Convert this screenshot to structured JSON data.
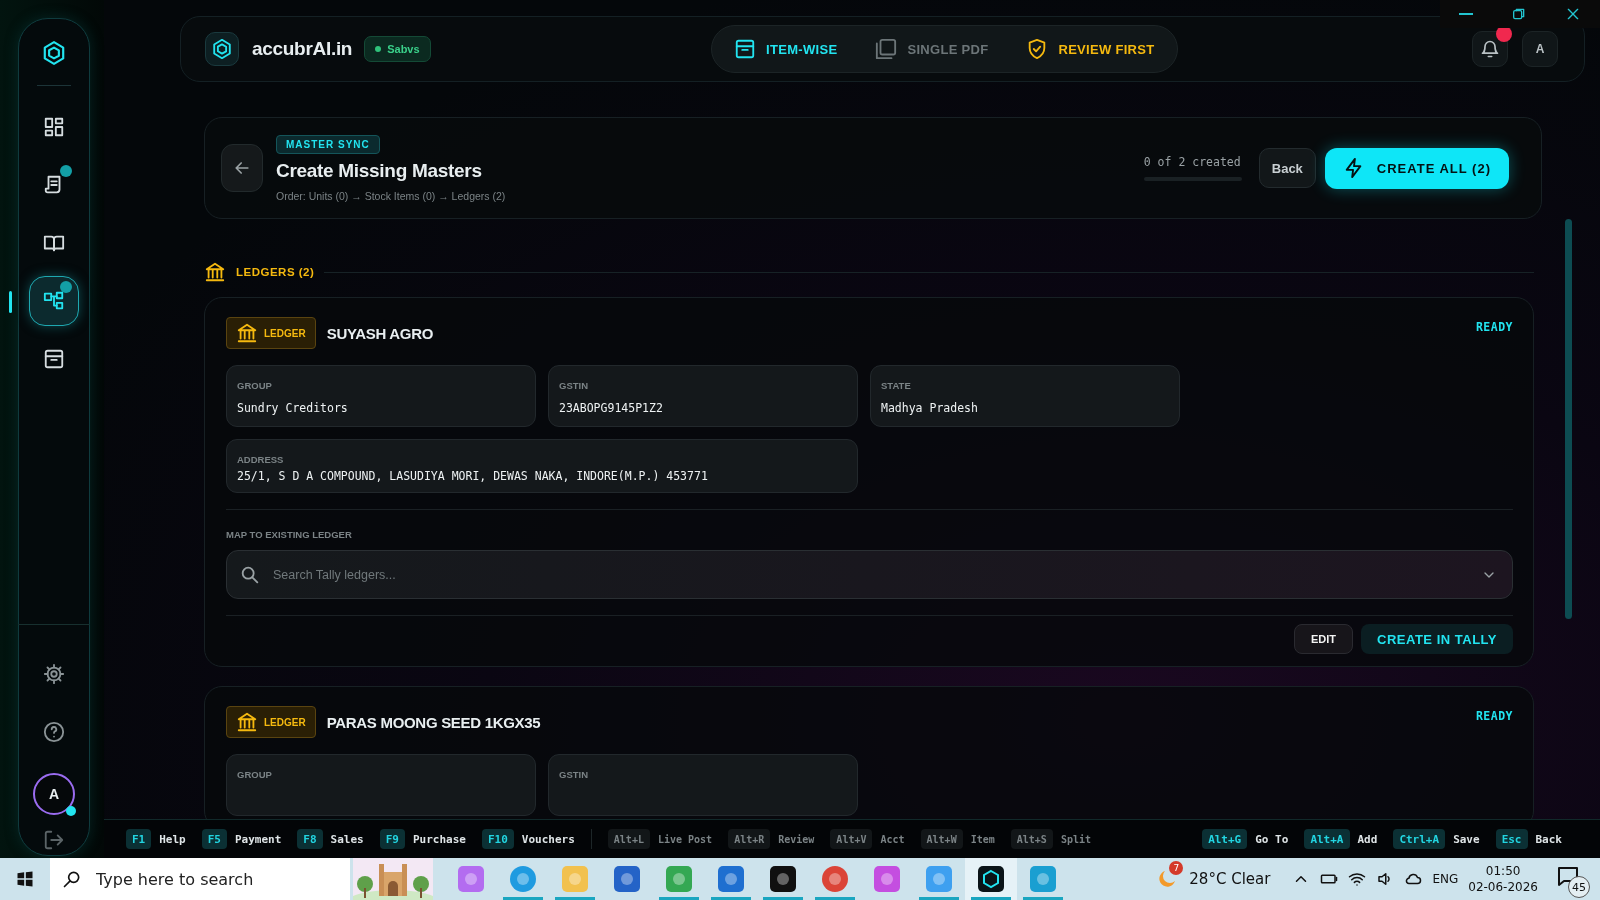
{
  "sidebar": {
    "items": [
      {
        "kind": "dashboard",
        "selected": false,
        "badge": false
      },
      {
        "kind": "invoice",
        "selected": false,
        "badge": true
      },
      {
        "kind": "book",
        "selected": false,
        "badge": false
      },
      {
        "kind": "sync",
        "selected": true,
        "badge": true
      },
      {
        "kind": "archive",
        "selected": false,
        "badge": false
      }
    ],
    "bottom_items": [
      {
        "kind": "settings"
      },
      {
        "kind": "help"
      }
    ],
    "avatar": "A"
  },
  "topbar": {
    "brand": "accubrAI.in",
    "company": "Sabvs",
    "modes": [
      {
        "label": "ITEM-WISE",
        "kind": "item",
        "selected": true
      },
      {
        "label": "SINGLE PDF",
        "kind": "pdf",
        "selected": false
      },
      {
        "label": "REVIEW FIRST",
        "kind": "review",
        "selected": false
      }
    ],
    "notifications": true,
    "avatar": "A"
  },
  "header": {
    "tag": "MASTER SYNC",
    "title": "Create Missing Masters",
    "subtitle": "Order: Units (0) → Stock Items (0) → Ledgers (2)",
    "progress": "0 of 2 created",
    "level": 0,
    "back": "Back",
    "create_all": "CREATE ALL (2)"
  },
  "section": {
    "title": "LEDGERS (2)"
  },
  "ledgers": [
    {
      "badge": "LEDGER",
      "name": "SUYASH AGRO",
      "status": "READY",
      "fields": [
        {
          "label": "GROUP",
          "value": "Sundry Creditors"
        },
        {
          "label": "GSTIN",
          "value": "23ABOPG9145P1Z2"
        },
        {
          "label": "STATE",
          "value": "Madhya Pradesh"
        }
      ],
      "address": {
        "label": "ADDRESS",
        "value": "25/1, S D A COMPOUND, LASUDIYA MORI, DEWAS NAKA, INDORE(M.P.) 453771"
      },
      "map_label": "MAP TO EXISTING LEDGER",
      "search": {
        "placeholder": "Search Tally ledgers..."
      },
      "actions": [
        "EDIT",
        "CREATE IN TALLY"
      ]
    },
    {
      "badge": "LEDGER",
      "name": "PARAS MOONG SEED 1KGX35",
      "status": "READY",
      "fields": [
        {
          "label": "GROUP"
        },
        {
          "label": "GSTIN"
        }
      ]
    }
  ],
  "shortcuts": {
    "left": [
      {
        "key": "F1",
        "label": "Help",
        "kind": "primary"
      },
      {
        "key": "F5",
        "label": "Payment",
        "kind": "primary"
      },
      {
        "key": "F8",
        "label": "Sales",
        "kind": "primary"
      },
      {
        "key": "F9",
        "label": "Purchase",
        "kind": "primary"
      },
      {
        "key": "F10",
        "label": "Vouchers",
        "kind": "primary"
      },
      {
        "key": "Alt+L",
        "label": "Live Post",
        "kind": "muted"
      },
      {
        "key": "Alt+R",
        "label": "Review",
        "kind": "muted"
      },
      {
        "key": "Alt+V",
        "label": "Acct",
        "kind": "muted"
      },
      {
        "key": "Alt+W",
        "label": "Item",
        "kind": "muted"
      },
      {
        "key": "Alt+S",
        "label": "Split",
        "kind": "muted"
      }
    ],
    "right": [
      {
        "key": "Alt+G",
        "label": "Go To",
        "kind": "primary"
      },
      {
        "key": "Alt+A",
        "label": "Add",
        "kind": "primary"
      },
      {
        "key": "Ctrl+A",
        "label": "Save",
        "kind": "primary"
      },
      {
        "key": "Esc",
        "label": "Back",
        "kind": "primary"
      }
    ]
  },
  "taskbar": {
    "search": {
      "placeholder": "Type here to search"
    },
    "apps": [
      {
        "kind": "copilot",
        "running": false,
        "selected": false
      },
      {
        "kind": "edge",
        "running": true,
        "selected": false
      },
      {
        "kind": "files",
        "running": true,
        "selected": false
      },
      {
        "kind": "store",
        "running": false,
        "selected": false
      },
      {
        "kind": "meet",
        "running": true,
        "selected": false
      },
      {
        "kind": "outlook",
        "running": true,
        "selected": false
      },
      {
        "kind": "arc",
        "running": true,
        "selected": false
      },
      {
        "kind": "chrome",
        "running": true,
        "selected": false
      },
      {
        "kind": "affinity",
        "running": false,
        "selected": false
      },
      {
        "kind": "photos",
        "running": true,
        "selected": false
      },
      {
        "kind": "accubr",
        "running": true,
        "selected": true
      },
      {
        "kind": "p",
        "running": true,
        "selected": false
      }
    ],
    "weather_badge": "7",
    "weather": "28°C  Clear",
    "language": "ENG",
    "time": "01:50",
    "date": "02-06-2026",
    "notifications": "45"
  }
}
